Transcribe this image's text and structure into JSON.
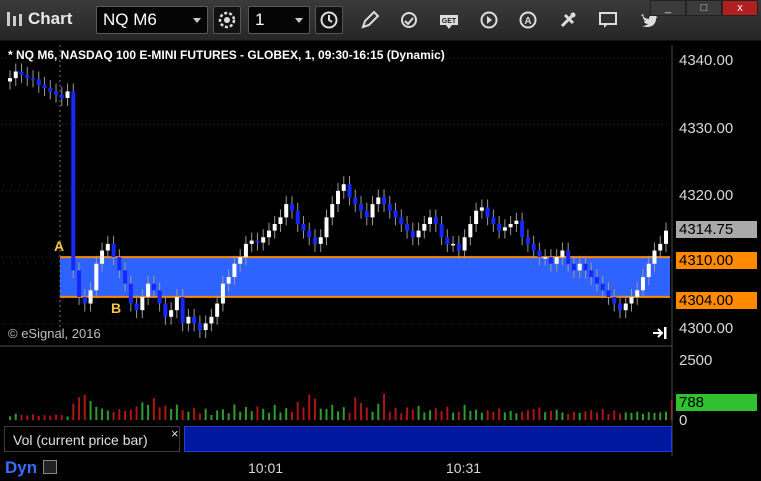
{
  "window": {
    "title": "Chart",
    "symbol": "NQ M6",
    "interval": "1",
    "window_controls": [
      "_",
      "□",
      "x"
    ]
  },
  "toolbar_icons": [
    "settings-icon",
    "clock-icon",
    "pencil-icon",
    "refresh-icon",
    "get-icon",
    "play-icon",
    "alert-icon",
    "tools-icon",
    "chat-icon",
    "twitter-icon"
  ],
  "chart": {
    "header": "* NQ M6, NASDAQ 100 E-MINI FUTURES - GLOBEX, 1, 09:30-16:15 (Dynamic)",
    "copyright": "© eSignal, 2016",
    "label_a": "A",
    "label_b": "B",
    "price_ticks": [
      "4340.00",
      "4330.00",
      "4320.00",
      "4310.00",
      "4300.00"
    ],
    "last_price": "4314.75",
    "range_high": "4310.00",
    "range_low": "4304.00",
    "volume_ticks": [
      "2500",
      "0"
    ],
    "current_volume": "788",
    "time_labels": [
      "10:01",
      "10:31"
    ],
    "colors": {
      "band": "#2f63ff",
      "range_lines": "#ff8a00",
      "up_candle": "#ffffff",
      "down_candle": "#1428ff",
      "vol_up": "#2f9e2f",
      "vol_down": "#b01515",
      "volume_badge": "#30c030"
    }
  },
  "volume_panel": {
    "title": "Vol (current price bar)",
    "close": "×"
  },
  "bottom": {
    "mode": "Dyn"
  },
  "chart_data": {
    "type": "candlestick",
    "title": "* NQ M6, NASDAQ 100 E-MINI FUTURES - GLOBEX, 1, 09:30-16:15 (Dynamic)",
    "y_ticks": [
      4300,
      4310,
      4320,
      4330,
      4340
    ],
    "ylim": [
      4297.5,
      4342
    ],
    "range_high": 4310.0,
    "range_low": 4304.0,
    "last_price": 4314.75,
    "x_ticks": [
      "10:01",
      "10:31"
    ],
    "close_series": [
      4337,
      4338,
      4337.5,
      4337,
      4336.8,
      4336,
      4335.5,
      4335,
      4334.5,
      4334,
      4335,
      4308,
      4304,
      4303,
      4305,
      4309,
      4311,
      4312,
      4310,
      4308,
      4306,
      4303,
      4302,
      4304,
      4306,
      4305,
      4303,
      4301,
      4302,
      4304,
      4300,
      4301,
      4300,
      4299,
      4300,
      4301,
      4303,
      4306,
      4307,
      4309,
      4310,
      4312,
      4312.5,
      4312.2,
      4313,
      4314,
      4315,
      4316,
      4318,
      4317,
      4315,
      4314,
      4313,
      4312,
      4313,
      4316,
      4318,
      4320,
      4321,
      4319,
      4318,
      4317,
      4316,
      4318,
      4319,
      4318,
      4317,
      4316,
      4315,
      4314,
      4313,
      4314,
      4315,
      4316,
      4315,
      4313,
      4312,
      4312,
      4311,
      4313,
      4315,
      4317,
      4317.5,
      4316,
      4315,
      4314,
      4314.5,
      4315,
      4315.5,
      4313,
      4312,
      4311,
      4310,
      4310,
      4309,
      4310,
      4311,
      4309,
      4308,
      4309,
      4308,
      4307,
      4306,
      4305,
      4304,
      4303,
      4302,
      4303,
      4304,
      4305,
      4307,
      4309,
      4311,
      4312,
      4314
    ],
    "volume_series": [
      150,
      250,
      200,
      180,
      220,
      160,
      190,
      170,
      210,
      200,
      140,
      650,
      900,
      1000,
      750,
      520,
      450,
      380,
      320,
      430,
      360,
      410,
      540,
      700,
      600,
      880,
      500,
      570,
      440,
      610,
      390,
      330,
      480,
      270,
      450,
      200,
      380,
      420,
      270,
      620,
      330,
      520,
      350,
      530,
      440,
      280,
      600,
      300,
      470,
      320,
      720,
      500,
      1000,
      850,
      450,
      430,
      600,
      340,
      510,
      290,
      900,
      680,
      500,
      330,
      640,
      1050,
      310,
      480,
      260,
      500,
      420,
      560,
      300,
      380,
      470,
      350,
      520,
      290,
      330,
      600,
      360,
      410,
      290,
      380,
      320,
      450,
      300,
      360,
      270,
      320,
      390,
      440,
      500,
      310,
      360,
      410,
      300,
      250,
      320,
      280,
      350,
      390,
      300,
      450,
      240,
      380,
      260,
      300,
      280,
      330,
      250,
      310,
      280,
      300,
      330,
      788
    ],
    "volume_ticks": [
      0,
      2500
    ],
    "current_volume": 788
  }
}
